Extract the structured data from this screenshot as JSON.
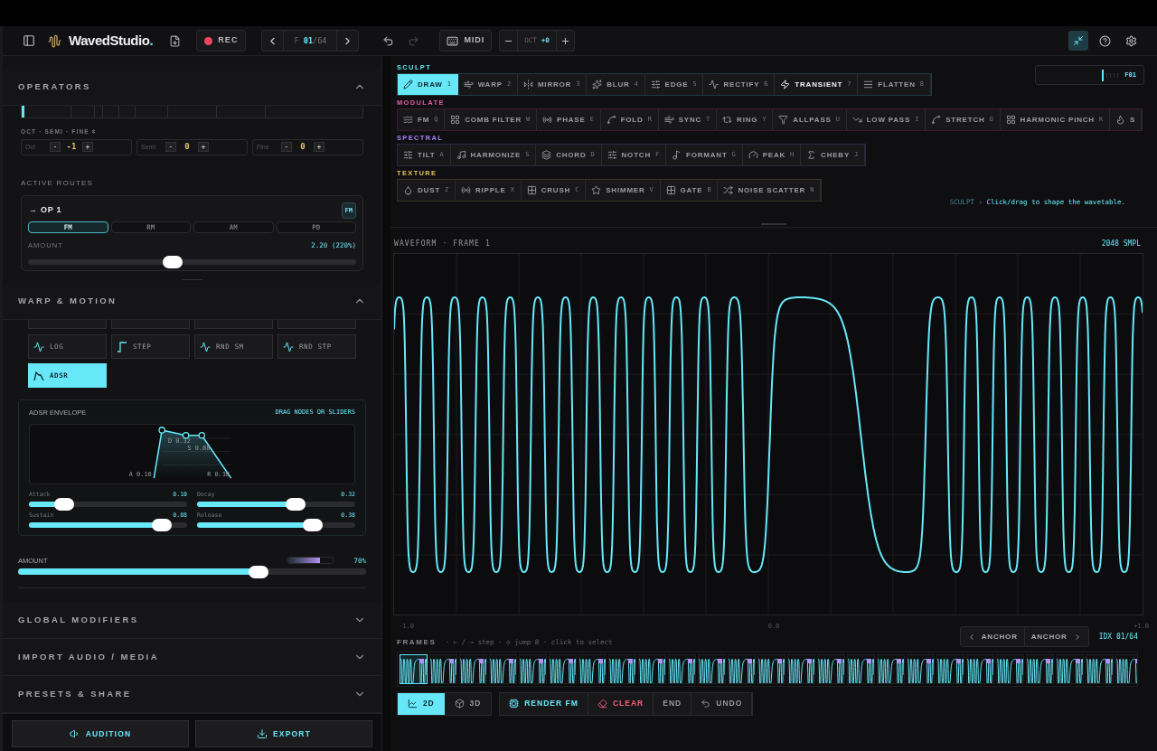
{
  "header": {
    "brand": "WavedStudio",
    "brand_dot": ".",
    "rec": "REC",
    "frame_prefix": "F",
    "frame_current": "01",
    "frame_total": "/64",
    "redo_disabled": true,
    "midi": "MIDI",
    "oct_label": "OCT",
    "oct_value": "+0",
    "compact_active": true
  },
  "operators": {
    "title": "OPERATORS",
    "expanded": true,
    "tuning_label": "OCT · SEMI · FINE ¢",
    "steppers": [
      {
        "label": "Oct",
        "dec": "-",
        "value": "-1",
        "inc": "+"
      },
      {
        "label": "Semi",
        "dec": "-",
        "value": "0",
        "inc": "+"
      },
      {
        "label": "Fine",
        "dec": "-",
        "value": "0",
        "inc": "+"
      }
    ],
    "routes_label": "ACTIVE ROUTES",
    "route": {
      "title": "→ OP 1",
      "badge": "FM",
      "modes": [
        {
          "label": "FM",
          "selected": true
        },
        {
          "label": "RM",
          "selected": false
        },
        {
          "label": "AM",
          "selected": false
        },
        {
          "label": "PD",
          "selected": false
        }
      ],
      "amount_label": "AMOUNT",
      "amount_value": "2.20 (220%)",
      "level": 0.44
    }
  },
  "warp_motion": {
    "title": "WARP & MOTION",
    "expanded": true,
    "curves": [
      {
        "label": "LOG",
        "selected": false
      },
      {
        "label": "STEP",
        "selected": false
      },
      {
        "label": "RND SM",
        "selected": false
      },
      {
        "label": "RND STP",
        "selected": false
      },
      {
        "label": "ADSR",
        "selected": true
      }
    ],
    "envelope": {
      "title": "ADSR ENVELOPE",
      "hint": "DRAG NODES OR SLIDERS",
      "graph_labels": [
        "D 0.32",
        "S 0.88",
        "A 0.10",
        "R 0.38"
      ],
      "params": [
        {
          "name": "Attack",
          "value": "0.10",
          "level": 0.22
        },
        {
          "name": "Decay",
          "value": "0.32",
          "level": 0.62
        },
        {
          "name": "Sustain",
          "value": "0.88",
          "level": 0.84
        },
        {
          "name": "Release",
          "value": "0.38",
          "level": 0.73
        }
      ]
    },
    "amount": {
      "label": "AMOUNT",
      "value": "70%",
      "level": 0.69,
      "meter": {
        "level": 0.7
      }
    }
  },
  "sections": [
    {
      "title": "GLOBAL MODIFIERS",
      "expanded": false
    },
    {
      "title": "IMPORT AUDIO / MEDIA",
      "expanded": false
    },
    {
      "title": "PRESETS & SHARE",
      "expanded": false
    }
  ],
  "footer_buttons": [
    "AUDITION",
    "EXPORT"
  ],
  "tool_groups": [
    {
      "title": "SCULPT",
      "color": "#5ee6f5",
      "tools": [
        {
          "label": "DRAW",
          "key": "1",
          "selected": true,
          "hovered": false
        },
        {
          "label": "WARP",
          "key": "2",
          "selected": false,
          "hovered": false
        },
        {
          "label": "MIRROR",
          "key": "3",
          "selected": false,
          "hovered": false
        },
        {
          "label": "BLUR",
          "key": "4",
          "selected": false,
          "hovered": false
        },
        {
          "label": "EDGE",
          "key": "5",
          "selected": false,
          "hovered": false
        },
        {
          "label": "RECTIFY",
          "key": "6",
          "selected": false,
          "hovered": false
        },
        {
          "label": "TRANSIENT",
          "key": "7",
          "selected": false,
          "hovered": true
        },
        {
          "label": "FLATTEN",
          "key": "8",
          "selected": false,
          "hovered": false
        }
      ]
    },
    {
      "title": "MODULATE",
      "color": "#e25aa9",
      "tools": [
        {
          "label": "FM",
          "key": "Q",
          "selected": false
        },
        {
          "label": "COMB FILTER",
          "key": "W",
          "selected": false
        },
        {
          "label": "PHASE",
          "key": "E",
          "selected": false
        },
        {
          "label": "FOLD",
          "key": "R",
          "selected": false
        },
        {
          "label": "SYNC",
          "key": "T",
          "selected": false
        },
        {
          "label": "RING",
          "key": "Y",
          "selected": false
        },
        {
          "label": "ALLPASS",
          "key": "U",
          "selected": false
        },
        {
          "label": "LOW PASS",
          "key": "I",
          "selected": false
        },
        {
          "label": "STRETCH",
          "key": "O",
          "selected": false
        },
        {
          "label": "HARMONIC PINCH",
          "key": "K",
          "selected": false
        },
        {
          "label": "S",
          "selected": false
        }
      ]
    },
    {
      "title": "SPECTRAL",
      "color": "#a783f2",
      "tools": [
        {
          "label": "TILT",
          "key": "A",
          "selected": false
        },
        {
          "label": "HARMONIZE",
          "key": "S",
          "selected": false
        },
        {
          "label": "CHORD",
          "key": "D",
          "selected": false
        },
        {
          "label": "NOTCH",
          "key": "F",
          "selected": false
        },
        {
          "label": "FORMANT",
          "key": "G",
          "selected": false
        },
        {
          "label": "PEAK",
          "key": "H",
          "selected": false
        },
        {
          "label": "CHEBY",
          "key": "J",
          "selected": false
        }
      ]
    },
    {
      "title": "TEXTURE",
      "color": "#e3c35a",
      "tools": [
        {
          "label": "DUST",
          "key": "Z",
          "selected": false
        },
        {
          "label": "RIPPLE",
          "key": "X",
          "selected": false
        },
        {
          "label": "CRUSH",
          "key": "C",
          "selected": false
        },
        {
          "label": "SHIMMER",
          "key": "V",
          "selected": false
        },
        {
          "label": "GATE",
          "key": "B",
          "selected": false
        },
        {
          "label": "NOISE SCATTER",
          "key": "N",
          "selected": false
        }
      ]
    }
  ],
  "hint": {
    "mode": "SCULPT",
    "sep": "›",
    "text": "Click/drag to shape the wavetable."
  },
  "scrubber": {
    "label": "F01"
  },
  "waveform": {
    "title": "WAVEFORM · FRAME 1",
    "samples": "2048 SMPL",
    "axis_labels": [
      "-1.0",
      "0.0",
      "+1.0"
    ]
  },
  "frames": {
    "title": "FRAMES",
    "hint": "· ← / → step · ◇ jump 8 · click to select",
    "anchor_prev": "ANCHOR",
    "anchor_next": "ANCHOR",
    "index": "IDX 01/64",
    "thumbnails": [
      {
        "selected": true
      },
      {
        "selected": false
      },
      {
        "selected": false
      },
      {
        "selected": false
      },
      {
        "selected": false
      },
      {
        "selected": false
      },
      {
        "selected": false
      },
      {
        "selected": false
      },
      {
        "selected": false
      },
      {
        "selected": false
      },
      {
        "selected": false
      },
      {
        "selected": false
      },
      {
        "selected": false
      },
      {
        "selected": false
      },
      {
        "selected": false
      },
      {
        "selected": false
      },
      {
        "selected": false
      },
      {
        "selected": false
      },
      {
        "selected": false
      },
      {
        "selected": false
      },
      {
        "selected": false
      },
      {
        "selected": false
      },
      {
        "selected": false
      },
      {
        "selected": false
      },
      {
        "selected": false
      }
    ]
  },
  "view_modes": [
    {
      "label": "2D",
      "selected": true
    },
    {
      "label": "3D",
      "selected": false
    }
  ],
  "actions": [
    {
      "label": "RENDER FM",
      "kind": "accent"
    },
    {
      "label": "CLEAR",
      "kind": "danger"
    },
    {
      "label": "END",
      "kind": "plain"
    },
    {
      "label": "UNDO",
      "kind": "plain"
    }
  ]
}
